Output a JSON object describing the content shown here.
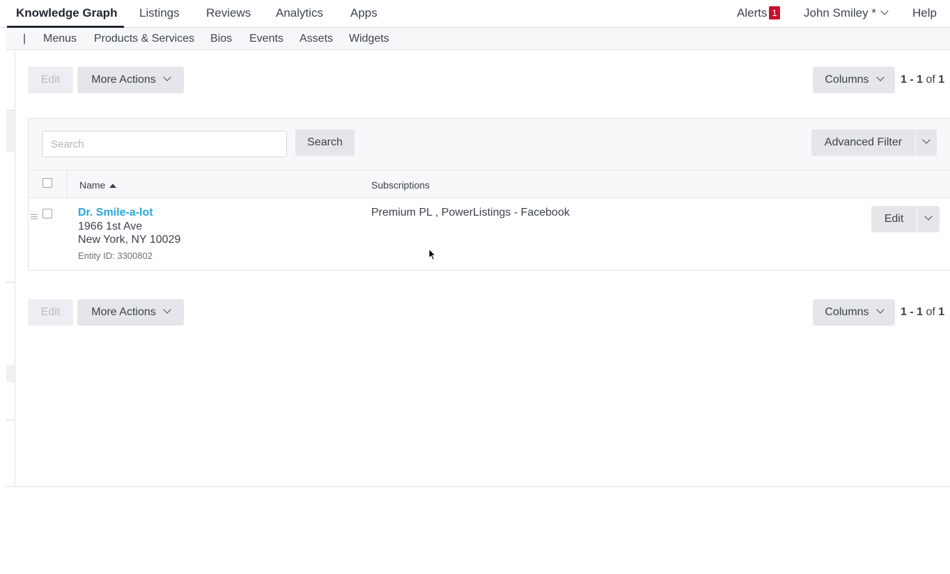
{
  "topnav": {
    "items": [
      "Knowledge Graph",
      "Listings",
      "Reviews",
      "Analytics",
      "Apps"
    ],
    "alerts_label": "Alerts",
    "alerts_count": "1",
    "user": "John Smiley *",
    "help": "Help"
  },
  "subnav": {
    "separator": "|",
    "items": [
      "Menus",
      "Products & Services",
      "Bios",
      "Events",
      "Assets",
      "Widgets"
    ]
  },
  "toolbar": {
    "edit_label": "Edit",
    "more_actions_label": "More Actions",
    "columns_label": "Columns",
    "pager": {
      "start": "1",
      "dash": " - ",
      "end": "1",
      "of": " of ",
      "total": "1"
    }
  },
  "search": {
    "placeholder": "Search",
    "button_label": "Search",
    "advanced_filter_label": "Advanced Filter"
  },
  "table": {
    "columns": [
      "Name",
      "Subscriptions"
    ],
    "rows": [
      {
        "name": "Dr. Smile-a-lot",
        "address_line1": "1966 1st Ave",
        "address_line2": "New York, NY 10029",
        "entity_id": "Entity ID: 3300802",
        "subscriptions": "Premium PL , PowerListings - Facebook",
        "edit_label": "Edit"
      }
    ]
  },
  "colors": {
    "link": "#27a7d8",
    "badge": "#c8102e",
    "button_bg": "#e4e6ea"
  }
}
